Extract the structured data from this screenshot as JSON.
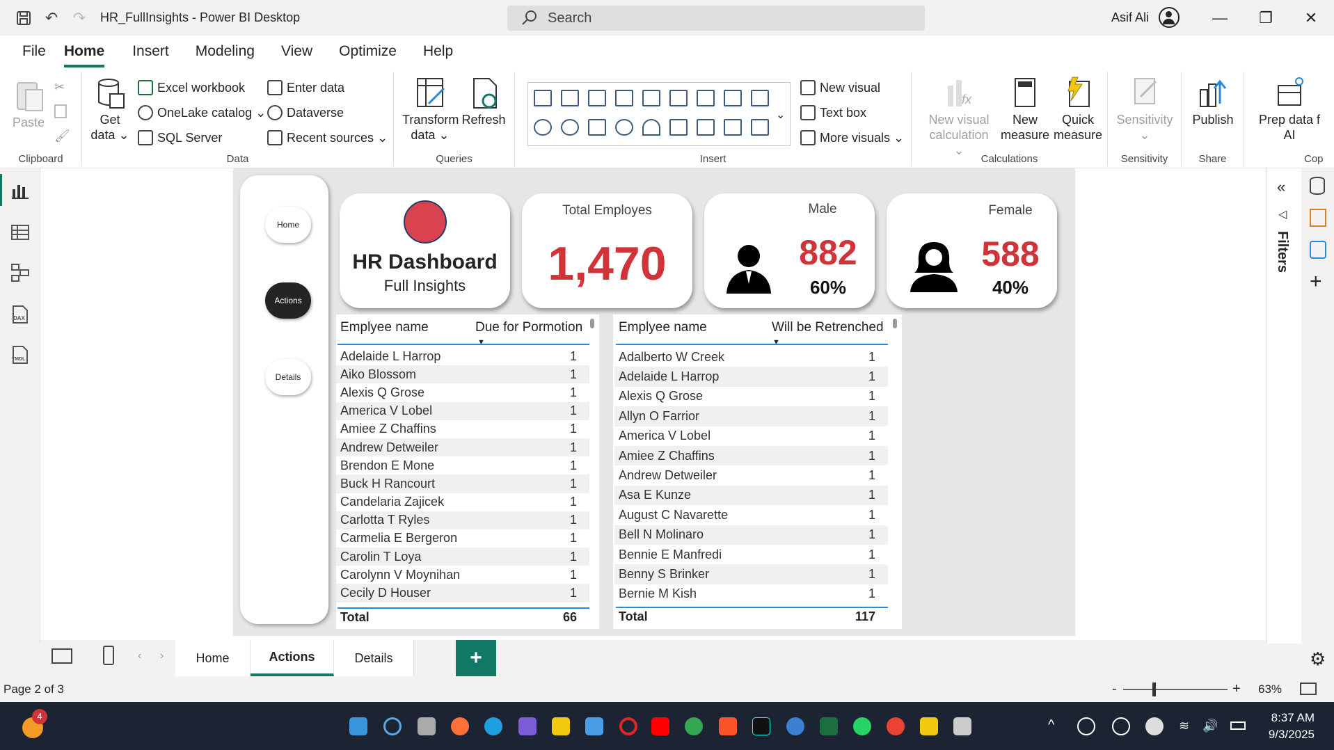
{
  "titlebar": {
    "title": "HR_FullInsights - Power BI Desktop",
    "search_placeholder": "Search",
    "user_name": "Asif Ali"
  },
  "menu": [
    "File",
    "Home",
    "Insert",
    "Modeling",
    "View",
    "Optimize",
    "Help"
  ],
  "ribbon": {
    "clipboard": {
      "paste": "Paste",
      "label": "Clipboard"
    },
    "data": {
      "get_data_1": "Get",
      "get_data_2": "data",
      "excel": "Excel workbook",
      "onelake": "OneLake catalog",
      "sql": "SQL Server",
      "enter": "Enter data",
      "dataverse": "Dataverse",
      "recent": "Recent sources",
      "label": "Data"
    },
    "queries": {
      "transform_1": "Transform",
      "transform_2": "data",
      "refresh": "Refresh",
      "label": "Queries"
    },
    "insert": {
      "new_visual": "New visual",
      "text_box": "Text box",
      "more_visuals": "More visuals",
      "label": "Insert"
    },
    "calculations": {
      "nvc_1": "New visual",
      "nvc_2": "calculation",
      "nm_1": "New",
      "nm_2": "measure",
      "qm_1": "Quick",
      "qm_2": "measure",
      "label": "Calculations"
    },
    "sensitivity": {
      "btn": "Sensitivity",
      "label": "Sensitivity"
    },
    "share": {
      "publish": "Publish",
      "label": "Share"
    },
    "copilot": {
      "prep_1": "Prep data f",
      "prep_2": "AI",
      "label": "Cop"
    }
  },
  "nav": {
    "home": "Home",
    "actions": "Actions",
    "details": "Details"
  },
  "cards": {
    "title_main": "HR Dashboard",
    "title_sub": "Full Insights",
    "total_label": "Total Employes",
    "total_value": "1,470",
    "male_label": "Male",
    "male_value": "882",
    "male_pct": "60%",
    "female_label": "Female",
    "female_value": "588",
    "female_pct": "40%"
  },
  "colors": {
    "accent": "#117865",
    "kpi_red": "#d13438",
    "logo_red": "#d9434f"
  },
  "table_promotion": {
    "col1": "Emplyee name",
    "col2": "Due for Pormotion",
    "rows": [
      {
        "name": "Adelaide L Harrop",
        "value": "1"
      },
      {
        "name": "Aiko Blossom",
        "value": "1"
      },
      {
        "name": "Alexis Q Grose",
        "value": "1"
      },
      {
        "name": "America V Lobel",
        "value": "1"
      },
      {
        "name": "Amiee Z Chaffins",
        "value": "1"
      },
      {
        "name": "Andrew Detweiler",
        "value": "1"
      },
      {
        "name": "Brendon E Mone",
        "value": "1"
      },
      {
        "name": "Buck H Rancourt",
        "value": "1"
      },
      {
        "name": "Candelaria Zajicek",
        "value": "1"
      },
      {
        "name": "Carlotta T Ryles",
        "value": "1"
      },
      {
        "name": "Carmelia E Bergeron",
        "value": "1"
      },
      {
        "name": "Carolin T Loya",
        "value": "1"
      },
      {
        "name": "Carolynn V Moynihan",
        "value": "1"
      },
      {
        "name": "Cecily D Houser",
        "value": "1"
      }
    ],
    "total_label": "Total",
    "total_value": "66"
  },
  "table_retrench": {
    "col1": "Emplyee name",
    "col2": "Will be Retrenched",
    "rows": [
      {
        "name": "Adalberto W Creek",
        "value": "1"
      },
      {
        "name": "Adelaide L Harrop",
        "value": "1"
      },
      {
        "name": "Alexis Q Grose",
        "value": "1"
      },
      {
        "name": "Allyn O Farrior",
        "value": "1"
      },
      {
        "name": "America V Lobel",
        "value": "1"
      },
      {
        "name": "Amiee Z Chaffins",
        "value": "1"
      },
      {
        "name": "Andrew Detweiler",
        "value": "1"
      },
      {
        "name": "Asa E Kunze",
        "value": "1"
      },
      {
        "name": "August C Navarette",
        "value": "1"
      },
      {
        "name": "Bell N Molinaro",
        "value": "1"
      },
      {
        "name": "Bennie E Manfredi",
        "value": "1"
      },
      {
        "name": "Benny S Brinker",
        "value": "1"
      },
      {
        "name": "Bernie M Kish",
        "value": "1"
      }
    ],
    "total_label": "Total",
    "total_value": "117"
  },
  "filters_label": "Filters",
  "page_tabs": [
    "Home",
    "Actions",
    "Details"
  ],
  "add_tab": "+",
  "status": {
    "page": "Page 2 of 3",
    "zoom": "63%",
    "minus": "-",
    "plus": "+"
  },
  "taskbar": {
    "badge": "4",
    "time": "8:37 AM",
    "date": "9/3/2025"
  }
}
